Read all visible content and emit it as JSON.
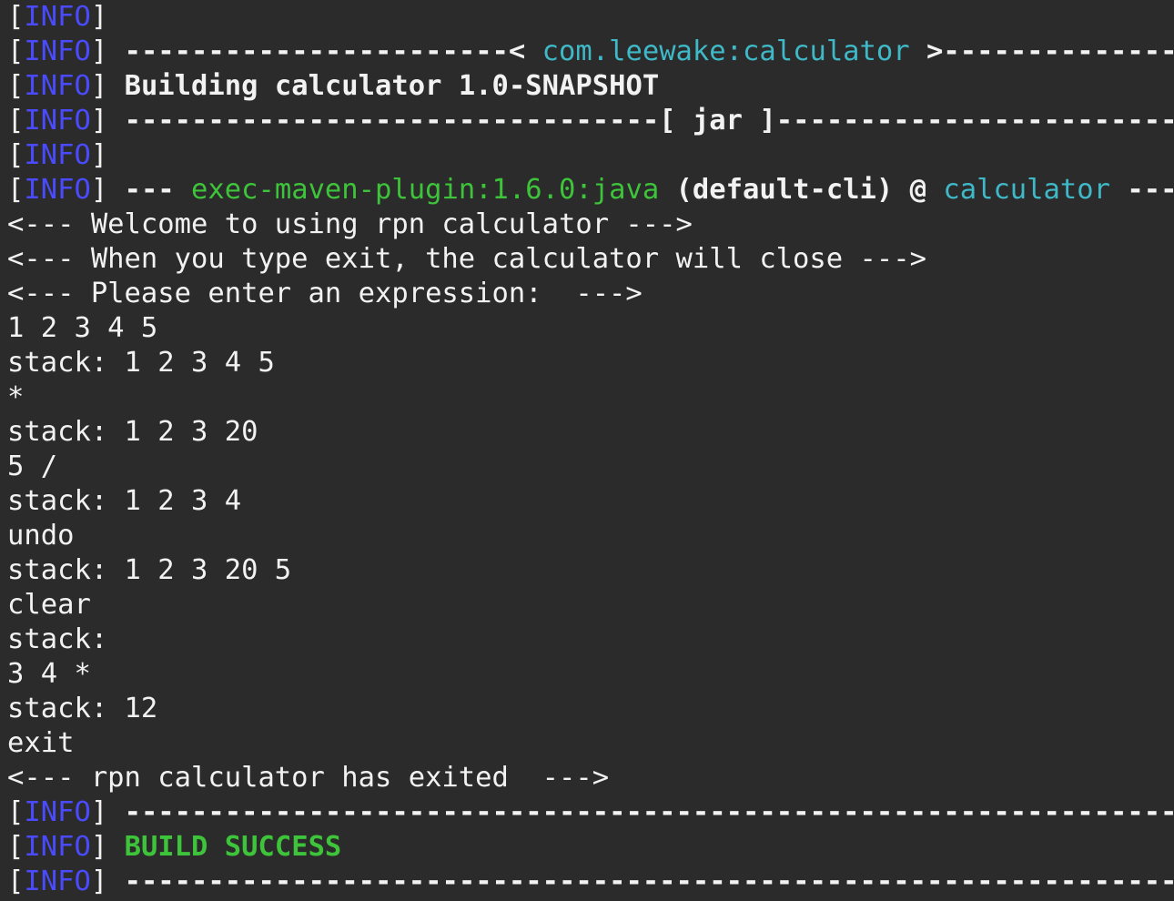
{
  "info_tag": "INFO",
  "colors": {
    "background": "#2b2b2b",
    "text": "#f2f2f2",
    "info_tag": "#4a4aff",
    "artifact_cyan": "#3fb9c8",
    "success_green": "#3ec43a"
  },
  "header": {
    "artifact_dashes_left": "-----------------------< ",
    "artifact": "com.leewake:calculator",
    "artifact_dashes_right": " >------------------------",
    "building": "Building calculator 1.0-SNAPSHOT",
    "jar_dashes_left": "--------------------------------[ ",
    "jar": "jar",
    "jar_dashes_right": " ]---------------------------------",
    "exec_prefix": "--- ",
    "exec_plugin": "exec-maven-plugin:1.6.0:java",
    "exec_cli": " (default-cli)",
    "exec_at": " @ ",
    "exec_project": "calculator",
    "exec_suffix": " ---"
  },
  "session": [
    "<--- Welcome to using rpn calculator --->",
    "<--- When you type exit, the calculator will close --->",
    "<--- Please enter an expression:  --->",
    "1 2 3 4 5",
    "stack: 1 2 3 4 5",
    "*",
    "stack: 1 2 3 20",
    "5 /",
    "stack: 1 2 3 4",
    "undo",
    "stack: 1 2 3 20 5",
    "clear",
    "stack:",
    "3 4 *",
    "stack: 12",
    "exit",
    "<--- rpn calculator has exited  --->"
  ],
  "footer": {
    "separator": "------------------------------------------------------------------------",
    "build_status": "BUILD SUCCESS"
  }
}
